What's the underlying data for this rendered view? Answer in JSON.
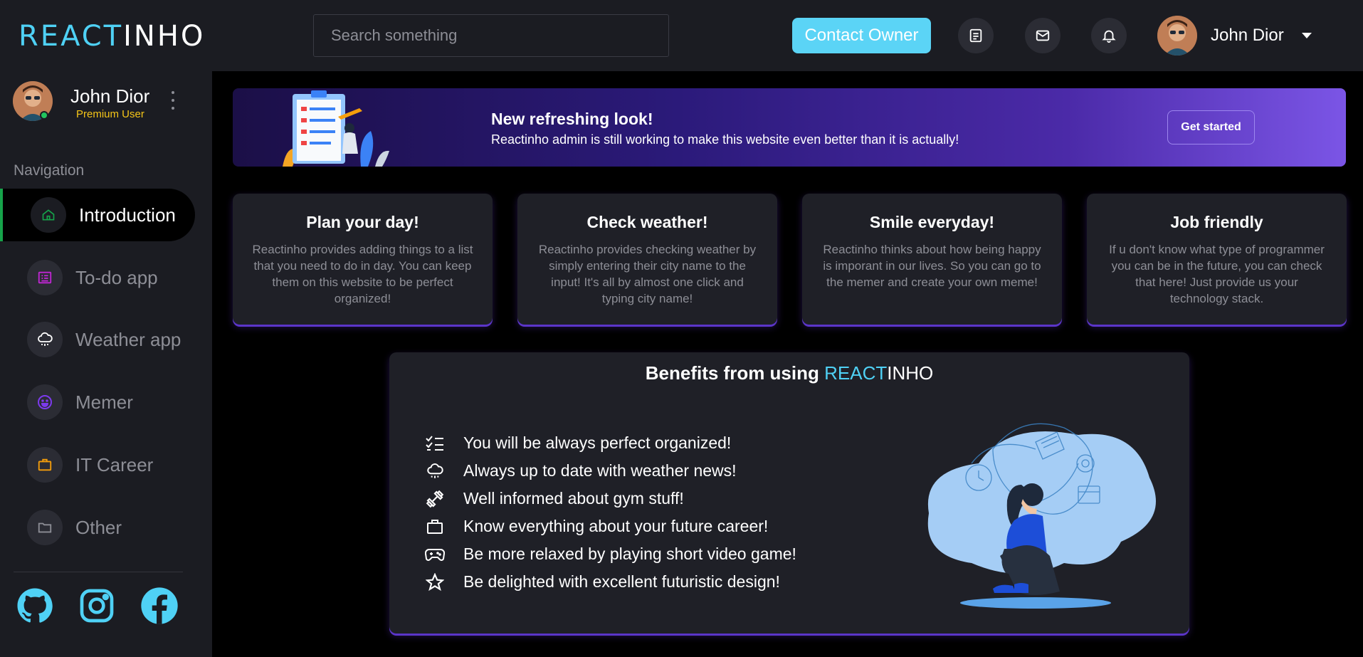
{
  "header": {
    "logo_part1": "REACT",
    "logo_part2": "INHO",
    "search_placeholder": "Search something",
    "contact_label": "Contact Owner",
    "user_name": "John Dior"
  },
  "sidebar": {
    "user_name": "John Dior",
    "user_role": "Premium User",
    "nav_title": "Navigation",
    "items": [
      {
        "label": "Introduction",
        "icon": "home-icon",
        "color": "#16a34a"
      },
      {
        "label": "To-do app",
        "icon": "todo-list-icon",
        "color": "#c026d3"
      },
      {
        "label": "Weather app",
        "icon": "cloud-rain-icon",
        "color": "#ffffff"
      },
      {
        "label": "Memer",
        "icon": "smile-icon",
        "color": "#7c3aed"
      },
      {
        "label": "IT Career",
        "icon": "briefcase-icon",
        "color": "#f59e0b"
      },
      {
        "label": "Other",
        "icon": "folder-icon",
        "color": "#8d8e96"
      }
    ],
    "social": [
      "github-icon",
      "instagram-icon",
      "facebook-icon"
    ]
  },
  "banner": {
    "title": "New refreshing look!",
    "text": "Reactinho admin is still working to make this website even better than it is actually!",
    "button": "Get started"
  },
  "cards": [
    {
      "title": "Plan your day!",
      "text": "Reactinho provides adding things to a list that you need to do in day. You can keep them on this website to be perfect organized!"
    },
    {
      "title": "Check weather!",
      "text": "Reactinho provides checking weather by simply entering their city name to the input! It's all by almost one click and typing city name!"
    },
    {
      "title": "Smile everyday!",
      "text": "Reactinho thinks about how being happy is imporant in our lives. So you can go to the memer and create your own meme!"
    },
    {
      "title": "Job friendly",
      "text": "If u don't know what type of programmer you can be in the future, you can check that here! Just provide us your technology stack."
    }
  ],
  "benefits": {
    "title_prefix": "Benefits from using ",
    "title_part1": "REACT",
    "title_part2": "INHO",
    "items": [
      "You will be always perfect organized!",
      "Always up to date with weather news!",
      "Well informed about gym stuff!",
      "Know everything about your future career!",
      "Be more relaxed by playing short video game!",
      "Be delighted with excellent futuristic design!"
    ]
  },
  "colors": {
    "accent": "#4fd1f5",
    "active_green": "#16a34a",
    "premium": "#f5c518",
    "card_glow": "#5b35c9"
  }
}
